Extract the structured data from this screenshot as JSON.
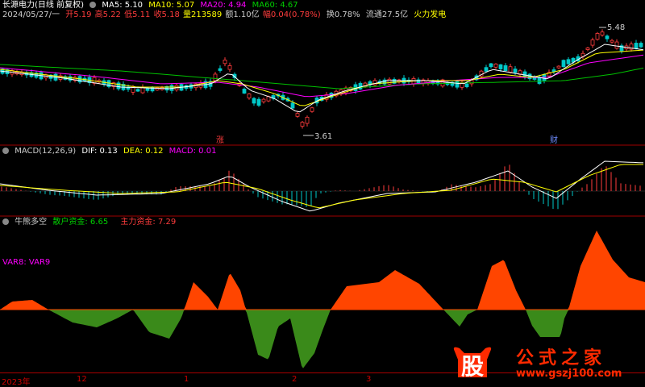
{
  "price_header": {
    "stock_name": "长源电力",
    "period": "(日线 前复权)",
    "ma5": "MA5: 5.10",
    "ma10": "MA10: 5.07",
    "ma20": "MA20: 4.94",
    "ma60": "MA60: 4.67",
    "date": "2024/05/27/一",
    "open": "开5.19",
    "high": "高5.22",
    "low": "低5.11",
    "close": "收5.18",
    "volume": "量213589",
    "amount": "额1.10亿",
    "change": "幅0.04(0.78%)",
    "turnover": "换0.78%",
    "float_cap": "流通27.5亿",
    "sector": "火力发电"
  },
  "price_annotations": {
    "high_label": "5.48",
    "low_label": "3.61",
    "marker1": "涨",
    "marker2": "财"
  },
  "macd_header": {
    "title": "MACD(12,26,9)",
    "dif": "DIF: 0.13",
    "dea": "DEA: 0.12",
    "macd": "MACD: 0.01"
  },
  "osc_header": {
    "title": "牛熊多空",
    "retail": "散户资金: 6.65",
    "main": "主力资金: 7.29",
    "var_label": "VAR8: VAR9"
  },
  "time_axis": [
    "2023年",
    "12",
    "1",
    "2",
    "3"
  ],
  "watermark": {
    "logo": "股",
    "site_name": "公式之家",
    "url": "www.gszj100.com"
  },
  "colors": {
    "up": "#ff3c3c",
    "down": "#00c8c8",
    "ma5": "#ffffff",
    "ma10": "#ffff00",
    "ma20": "#ff00ff",
    "ma60": "#00c000",
    "fill_pos": "#ff4500",
    "fill_neg": "#3a8a1a",
    "grid": "#a00000"
  }
}
